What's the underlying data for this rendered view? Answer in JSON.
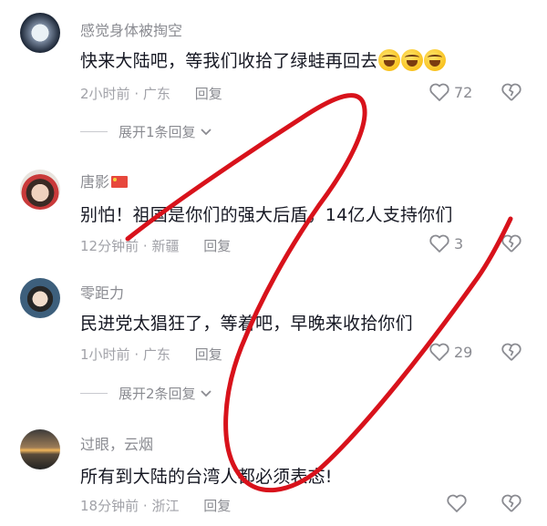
{
  "comments": [
    {
      "username": "感觉身体被掏空",
      "text": "快来大陆吧，等我们收拾了绿蛙再回去",
      "emoji_icon": "laughing-crying-emoji-icon",
      "time": "2小时前",
      "location": "广东",
      "reply": "回复",
      "likes": "72",
      "expand": "展开1条回复"
    },
    {
      "username": "唐影",
      "badge_icon": "china-flag-icon",
      "text": "别怕！祖国是你们的强大后盾，14亿人支持你们",
      "time": "12分钟前",
      "location": "新疆",
      "reply": "回复",
      "likes": "3"
    },
    {
      "username": "零距力",
      "text": "民进党太猖狂了，等着吧，早晚来收拾你们",
      "time": "1小时前",
      "location": "广东",
      "reply": "回复",
      "likes": "29",
      "expand": "展开2条回复"
    },
    {
      "username": "过眼，云烟",
      "text": "所有到大陆的台湾人都必须表态!",
      "time": "18分钟前",
      "location": "浙江",
      "reply": "回复",
      "likes": ""
    }
  ],
  "separator": "·",
  "annotation_color": "#d8121b"
}
